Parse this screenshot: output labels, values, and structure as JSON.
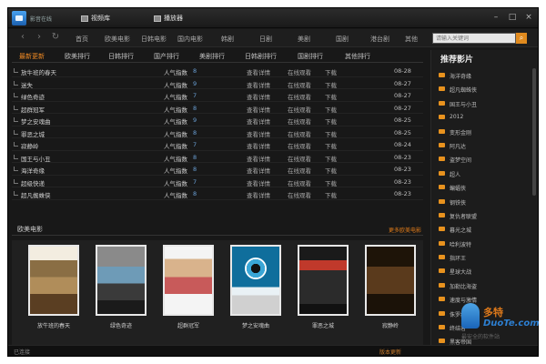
{
  "app": {
    "title": "影音在线"
  },
  "top_tabs": [
    {
      "label": "视频库"
    },
    {
      "label": "播放器"
    }
  ],
  "window_controls": [
    "–",
    "□",
    "×"
  ],
  "nav": {
    "items": [
      "首页",
      "欧美电影",
      "日韩电影",
      "国内电影",
      "韩剧",
      "日剧",
      "美剧",
      "国剧",
      "港台剧",
      "其他"
    ],
    "search_placeholder": "请输入关键词",
    "search_icon": "search-icon"
  },
  "category_tabs": [
    {
      "label": "最新更新",
      "active": true
    },
    {
      "label": "欧美排行",
      "active": false
    },
    {
      "label": "日韩排行",
      "active": false
    },
    {
      "label": "国产排行",
      "active": false
    },
    {
      "label": "美剧排行",
      "active": false
    },
    {
      "label": "日韩剧排行",
      "active": false
    },
    {
      "label": "国剧排行",
      "active": false
    },
    {
      "label": "其他排行",
      "active": false
    }
  ],
  "table": {
    "rows": [
      {
        "title": "放牛班的春天",
        "pop": "人气指数",
        "score": "8",
        "a1": "查看详情",
        "a2": "在线观看",
        "a3": "下载",
        "date": "08-28"
      },
      {
        "title": "迷失",
        "pop": "人气指数",
        "score": "9",
        "a1": "查看详情",
        "a2": "在线观看",
        "a3": "下载",
        "date": "08-27"
      },
      {
        "title": "绿色奇迹",
        "pop": "人气指数",
        "score": "7",
        "a1": "查看详情",
        "a2": "在线观看",
        "a3": "下载",
        "date": "08-27"
      },
      {
        "title": "超群冠军",
        "pop": "人气指数",
        "score": "8",
        "a1": "查看详情",
        "a2": "在线观看",
        "a3": "下载",
        "date": "08-27"
      },
      {
        "title": "梦之安魂曲",
        "pop": "人气指数",
        "score": "9",
        "a1": "查看详情",
        "a2": "在线观看",
        "a3": "下载",
        "date": "08-25"
      },
      {
        "title": "罪恶之城",
        "pop": "人气指数",
        "score": "8",
        "a1": "查看详情",
        "a2": "在线观看",
        "a3": "下载",
        "date": "08-25"
      },
      {
        "title": "寂静岭",
        "pop": "人气指数",
        "score": "7",
        "a1": "查看详情",
        "a2": "在线观看",
        "a3": "下载",
        "date": "08-24"
      },
      {
        "title": "国王与小丑",
        "pop": "人气指数",
        "score": "8",
        "a1": "查看详情",
        "a2": "在线观看",
        "a3": "下载",
        "date": "08-23"
      },
      {
        "title": "海洋奇缘",
        "pop": "人气指数",
        "score": "8",
        "a1": "查看详情",
        "a2": "在线观看",
        "a3": "下载",
        "date": "08-23"
      },
      {
        "title": "超级快递",
        "pop": "人气指数",
        "score": "7",
        "a1": "查看详情",
        "a2": "在线观看",
        "a3": "下载",
        "date": "08-23"
      },
      {
        "title": "超凡蜘蛛侠",
        "pop": "人气指数",
        "score": "8",
        "a1": "查看详情",
        "a2": "在线观看",
        "a3": "下载",
        "date": "08-23"
      }
    ]
  },
  "featured": {
    "title": "欧美电影",
    "more": "更多欧美电影",
    "posters": [
      {
        "caption": "放牛班的春天"
      },
      {
        "caption": "绿色奇迹"
      },
      {
        "caption": "超群冠军"
      },
      {
        "caption": "梦之安魂曲"
      },
      {
        "caption": "罪恶之城"
      },
      {
        "caption": "寂静岭"
      }
    ]
  },
  "sidebar": {
    "title": "推荐影片",
    "items": [
      "海洋奇缘",
      "超凡蜘蛛侠",
      "国王与小丑",
      "2012",
      "变形金刚",
      "阿凡达",
      "盗梦空间",
      "超人",
      "蝙蝠侠",
      "钢铁侠",
      "复仇者联盟",
      "暮光之城",
      "哈利波特",
      "指环王",
      "星球大战",
      "加勒比海盗",
      "速度与激情",
      "侏罗纪公园",
      "终结者",
      "黑客帝国",
      "泰坦尼克号"
    ]
  },
  "status": {
    "left": "已连接",
    "right": "版本更新"
  },
  "watermark": {
    "line1": "多特",
    "line2": "DuoTe.com",
    "line3": "最安全的软件站"
  },
  "colors": {
    "accent": "#f08a24",
    "background": "#181818",
    "link_blue": "#6aa0d6"
  }
}
